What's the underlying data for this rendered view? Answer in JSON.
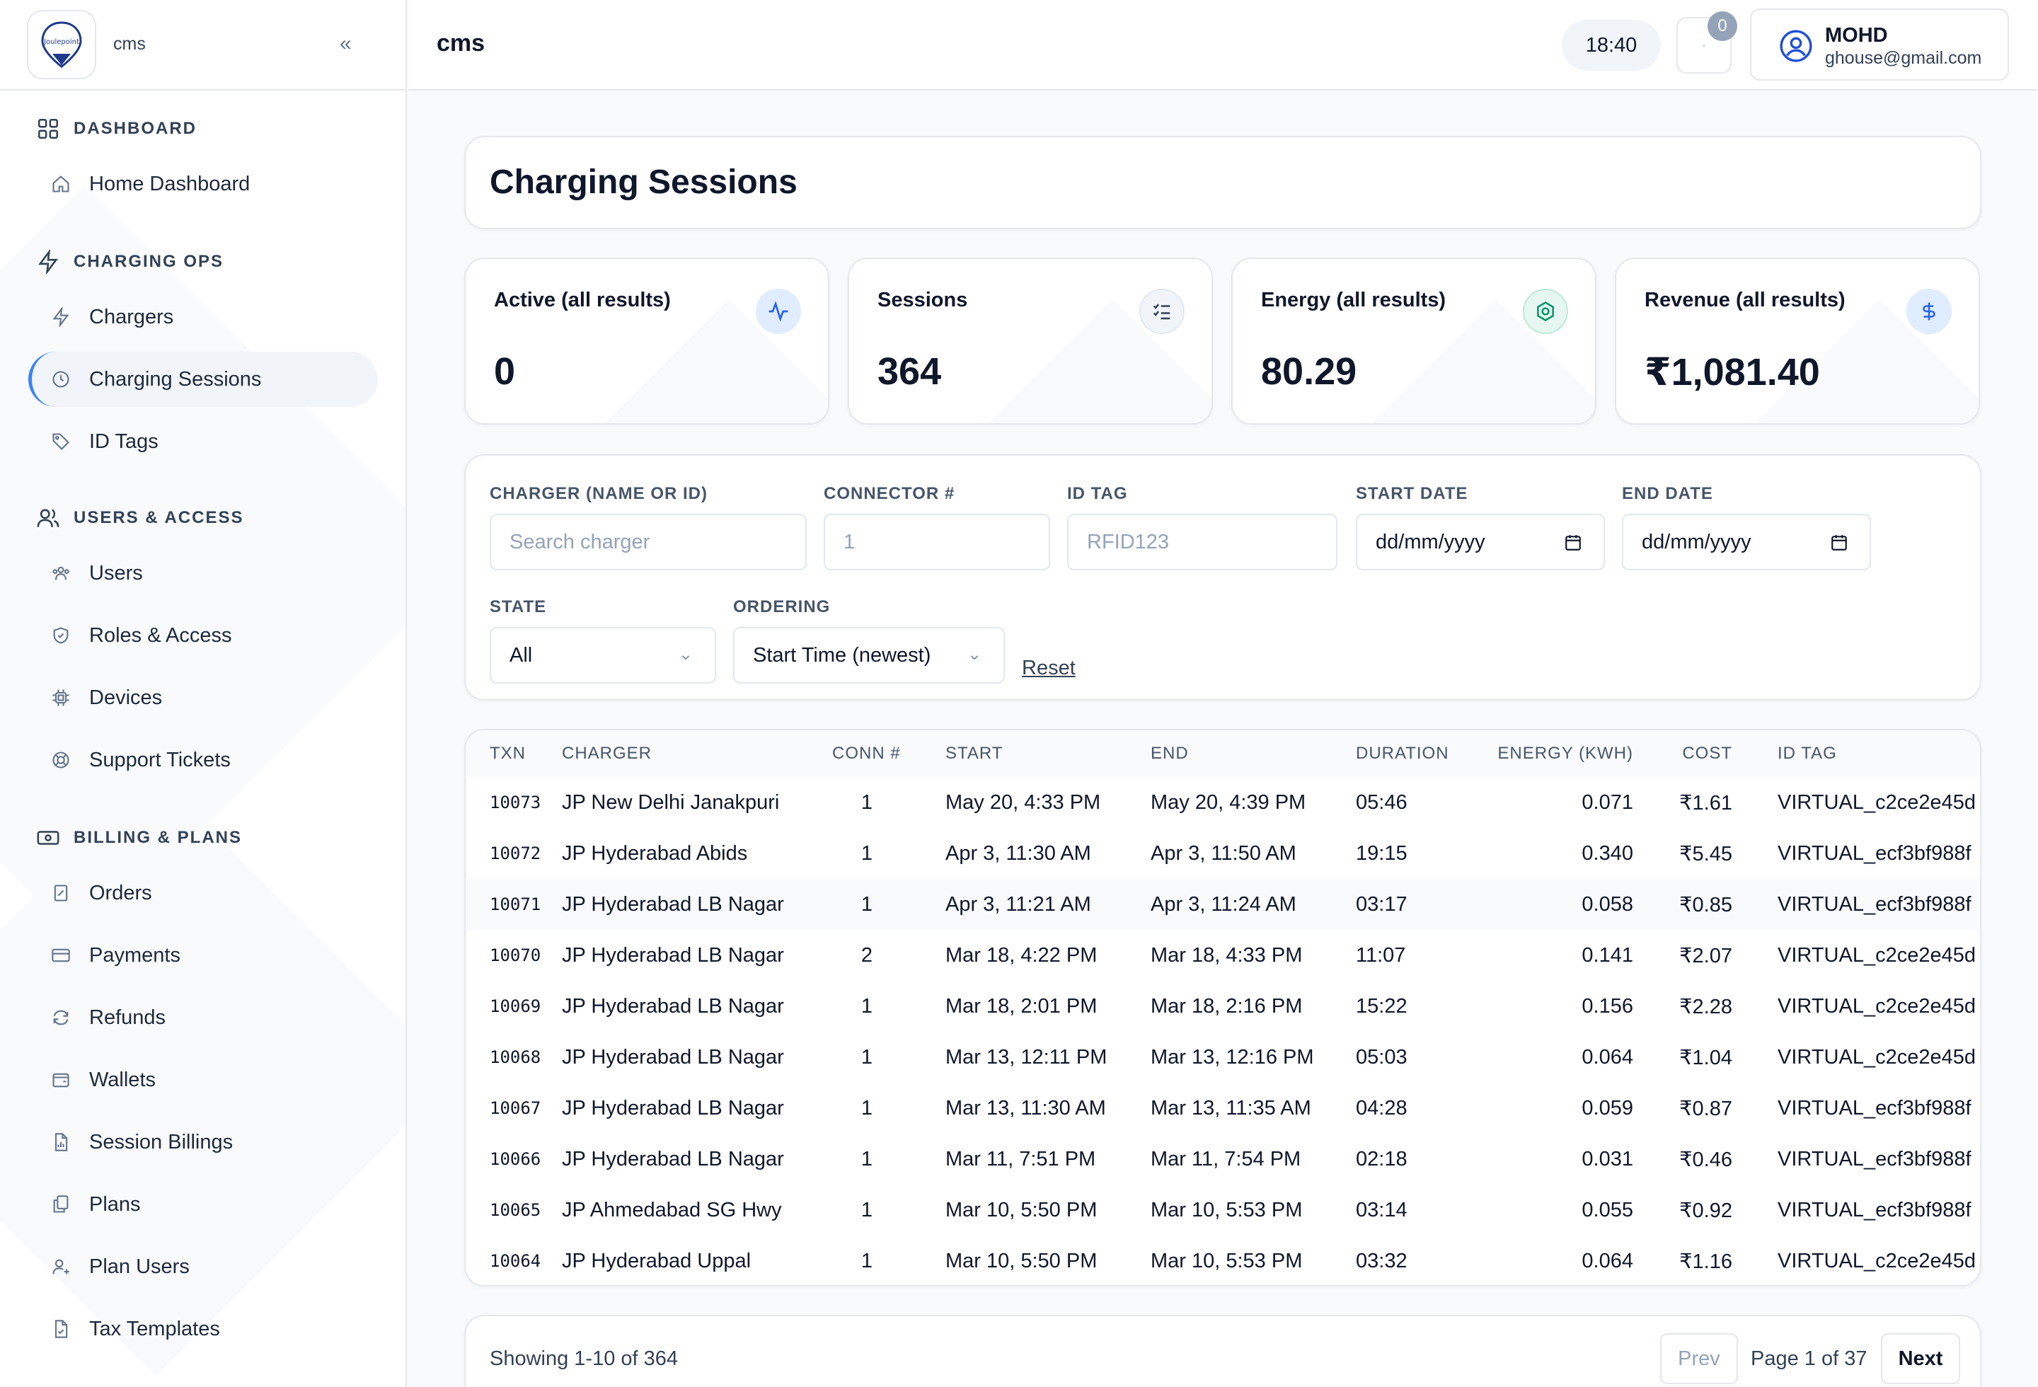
{
  "sidebar": {
    "brand": "cms",
    "logo_text": "Joulepoint",
    "collapse_glyph": "«",
    "sections": {
      "dashboard": "DASHBOARD",
      "charging_ops": "CHARGING OPS",
      "users_access": "USERS & ACCESS",
      "billing_plans": "BILLING & PLANS"
    },
    "items": {
      "home_dashboard": "Home Dashboard",
      "chargers": "Chargers",
      "charging_sessions": "Charging Sessions",
      "id_tags": "ID Tags",
      "users": "Users",
      "roles_access": "Roles & Access",
      "devices": "Devices",
      "support_tickets": "Support Tickets",
      "orders": "Orders",
      "payments": "Payments",
      "refunds": "Refunds",
      "wallets": "Wallets",
      "session_billings": "Session Billings",
      "plans": "Plans",
      "plan_users": "Plan Users",
      "tax_templates": "Tax Templates"
    },
    "active_item": "charging_sessions"
  },
  "topbar": {
    "title": "cms",
    "time": "18:40",
    "notification_count": "0",
    "user_name": "MOHD",
    "user_email": "ghouse@gmail.com"
  },
  "page": {
    "title": "Charging Sessions"
  },
  "stats": [
    {
      "label": "Active (all results)",
      "value": "0",
      "icon": "activity-icon",
      "color": "#3b82f6"
    },
    {
      "label": "Sessions",
      "value": "364",
      "icon": "list-checks-icon",
      "color": "#475569"
    },
    {
      "label": "Energy (all results)",
      "value": "80.29",
      "icon": "energy-icon",
      "color": "#10b981"
    },
    {
      "label": "Revenue (all results)",
      "value": "₹1,081.40",
      "icon": "dollar-icon",
      "color": "#3b82f6"
    }
  ],
  "filters": {
    "charger_label": "CHARGER (NAME OR ID)",
    "charger_placeholder": "Search charger",
    "connector_label": "CONNECTOR #",
    "connector_placeholder": "1",
    "idtag_label": "ID TAG",
    "idtag_placeholder": "RFID123",
    "start_label": "START DATE",
    "start_value": "dd/mm/yyyy",
    "end_label": "END DATE",
    "end_value": "dd/mm/yyyy",
    "state_label": "STATE",
    "state_value": "All",
    "ordering_label": "ORDERING",
    "ordering_value": "Start Time (newest)",
    "reset_label": "Reset"
  },
  "table": {
    "columns": [
      "TXN",
      "CHARGER",
      "CONN #",
      "START",
      "END",
      "DURATION",
      "ENERGY (KWH)",
      "COST",
      "ID TAG"
    ],
    "rows": [
      [
        "10073",
        "JP New Delhi Janakpuri",
        "1",
        "May 20, 4:33 PM",
        "May 20, 4:39 PM",
        "05:46",
        "0.071",
        "₹1.61",
        "VIRTUAL_c2ce2e45d"
      ],
      [
        "10072",
        "JP Hyderabad Abids",
        "1",
        "Apr 3, 11:30 AM",
        "Apr 3, 11:50 AM",
        "19:15",
        "0.340",
        "₹5.45",
        "VIRTUAL_ecf3bf988f"
      ],
      [
        "10071",
        "JP Hyderabad LB Nagar",
        "1",
        "Apr 3, 11:21 AM",
        "Apr 3, 11:24 AM",
        "03:17",
        "0.058",
        "₹0.85",
        "VIRTUAL_ecf3bf988f"
      ],
      [
        "10070",
        "JP Hyderabad LB Nagar",
        "2",
        "Mar 18, 4:22 PM",
        "Mar 18, 4:33 PM",
        "11:07",
        "0.141",
        "₹2.07",
        "VIRTUAL_c2ce2e45d"
      ],
      [
        "10069",
        "JP Hyderabad LB Nagar",
        "1",
        "Mar 18, 2:01 PM",
        "Mar 18, 2:16 PM",
        "15:22",
        "0.156",
        "₹2.28",
        "VIRTUAL_c2ce2e45d"
      ],
      [
        "10068",
        "JP Hyderabad LB Nagar",
        "1",
        "Mar 13, 12:11 PM",
        "Mar 13, 12:16 PM",
        "05:03",
        "0.064",
        "₹1.04",
        "VIRTUAL_c2ce2e45d"
      ],
      [
        "10067",
        "JP Hyderabad LB Nagar",
        "1",
        "Mar 13, 11:30 AM",
        "Mar 13, 11:35 AM",
        "04:28",
        "0.059",
        "₹0.87",
        "VIRTUAL_ecf3bf988f"
      ],
      [
        "10066",
        "JP Hyderabad LB Nagar",
        "1",
        "Mar 11, 7:51 PM",
        "Mar 11, 7:54 PM",
        "02:18",
        "0.031",
        "₹0.46",
        "VIRTUAL_ecf3bf988f"
      ],
      [
        "10065",
        "JP Ahmedabad SG Hwy",
        "1",
        "Mar 10, 5:50 PM",
        "Mar 10, 5:53 PM",
        "03:14",
        "0.055",
        "₹0.92",
        "VIRTUAL_ecf3bf988f"
      ],
      [
        "10064",
        "JP Hyderabad Uppal",
        "1",
        "Mar 10, 5:50 PM",
        "Mar 10, 5:53 PM",
        "03:32",
        "0.064",
        "₹1.16",
        "VIRTUAL_c2ce2e45d"
      ]
    ]
  },
  "pagination": {
    "info": "Showing 1-10 of 364",
    "prev_label": "Prev",
    "page_label": "Page 1 of 37",
    "next_label": "Next"
  }
}
